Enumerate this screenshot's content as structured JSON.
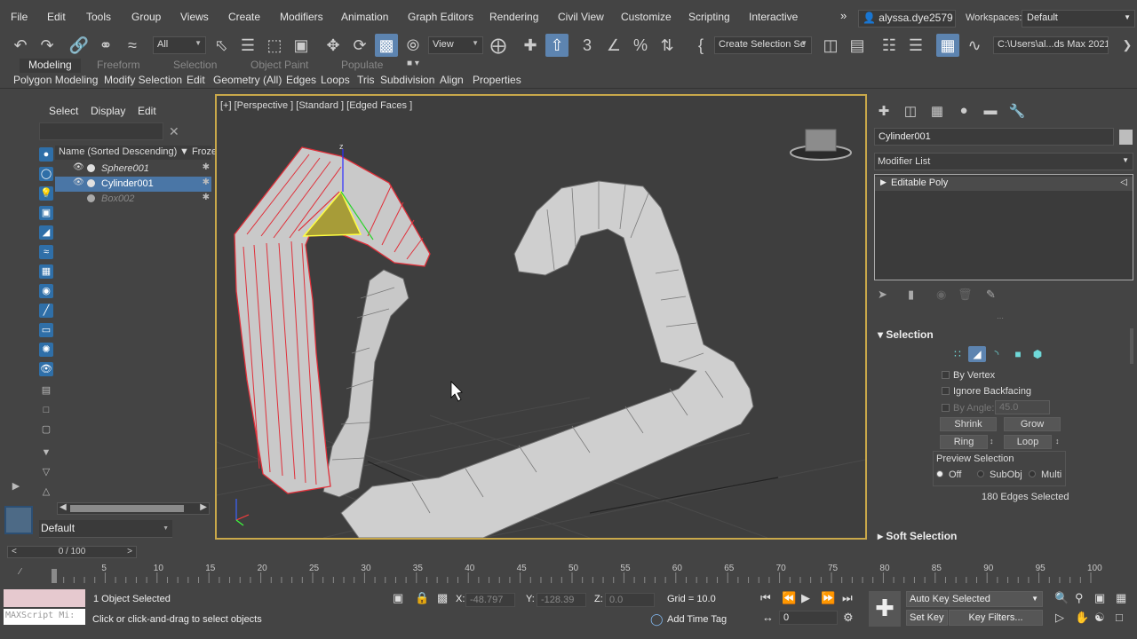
{
  "menu": [
    "File",
    "Edit",
    "Tools",
    "Group",
    "Views",
    "Create",
    "Modifiers",
    "Animation",
    "Graph Editors",
    "Rendering",
    "Civil View",
    "Customize",
    "Scripting",
    "Interactive"
  ],
  "user": "alyssa.dye2579",
  "workspaces": {
    "label": "Workspaces:",
    "value": "Default"
  },
  "toolbar": {
    "filter": "All",
    "refcoord": "View",
    "named_sel": "Create Selection Se",
    "path": "C:\\Users\\al...ds Max 2021"
  },
  "ribbon": {
    "tabs": [
      "Modeling",
      "Freeform",
      "Selection",
      "Object Paint",
      "Populate"
    ],
    "sub": [
      "Polygon Modeling",
      "Modify Selection",
      "Edit",
      "Geometry (All)",
      "Edges",
      "Loops",
      "Tris",
      "Subdivision",
      "Align",
      "Properties"
    ]
  },
  "explorer": {
    "menu": [
      "Select",
      "Display",
      "Edit"
    ],
    "header": "Name (Sorted Descending)",
    "frozen": "Frozen",
    "rows": [
      {
        "name": "Sphere001"
      },
      {
        "name": "Cylinder001"
      },
      {
        "name": "Box002"
      }
    ],
    "layer": "Default"
  },
  "viewport": {
    "label": "[+] [Perspective ] [Standard ] [Edged Faces ]",
    "axis_z": "z"
  },
  "command_panel": {
    "object_name": "Cylinder001",
    "modifier_list": "Modifier List",
    "stack_item": "Editable Poly",
    "selection": {
      "title": "Selection",
      "by_vertex": "By Vertex",
      "ignore_backfacing": "Ignore Backfacing",
      "by_angle": "By Angle:",
      "angle_value": "45.0",
      "shrink": "Shrink",
      "grow": "Grow",
      "ring": "Ring",
      "loop": "Loop",
      "preview_selection": "Preview Selection",
      "preview_off": "Off",
      "preview_subobj": "SubObj",
      "preview_multi": "Multi",
      "summary": "180 Edges Selected"
    },
    "soft_selection": "Soft Selection"
  },
  "timeline": {
    "frame": "0 / 100",
    "ticks": [
      "5",
      "10",
      "15",
      "20",
      "25",
      "30",
      "35",
      "40",
      "45",
      "50",
      "55",
      "60",
      "65",
      "70",
      "75",
      "80",
      "85",
      "90",
      "95",
      "100"
    ]
  },
  "status": {
    "objects": "1 Object Selected",
    "prompt": "Click or click-and-drag to select objects",
    "maxscript": "MAXScript Mi:",
    "x_label": "X:",
    "x": "-48.797",
    "y_label": "Y:",
    "y": "-128.39",
    "z_label": "Z:",
    "z": "0.0",
    "grid": "Grid = 10.0",
    "add_time_tag": "Add Time Tag",
    "auto_key": "Auto Key",
    "set_key": "Set Key",
    "selected": "Selected",
    "key_filters": "Key Filters...",
    "frame_field": "0"
  },
  "colors": {
    "accent": "#5d84b0",
    "viewport_border": "#c9a84a",
    "selected_edges": "#e0303a"
  }
}
